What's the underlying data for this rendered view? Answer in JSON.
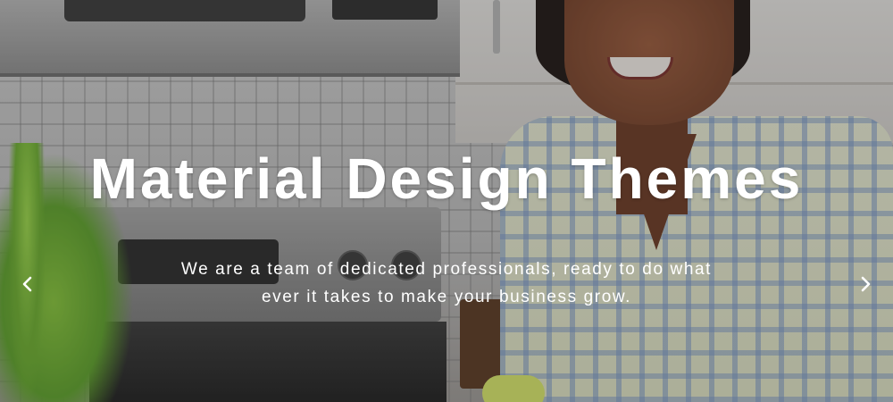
{
  "hero": {
    "title": "Material Design Themes",
    "subtitle": "We are a team of dedicated professionals, ready to do what ever it takes to make your business grow."
  },
  "carousel": {
    "prev_icon": "chevron-left-icon",
    "next_icon": "chevron-right-icon",
    "arrow_color": "#ffffff"
  },
  "colors": {
    "text": "#ffffff",
    "overlay": "rgba(40,40,40,0.28)"
  }
}
